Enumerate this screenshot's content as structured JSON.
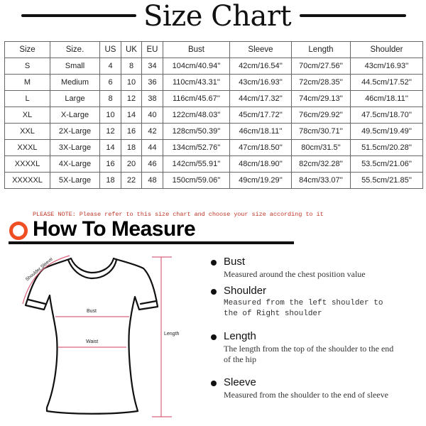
{
  "header": {
    "title": "Size Chart"
  },
  "size_table": {
    "columns": [
      "Size",
      "Size.",
      "US",
      "UK",
      "EU",
      "Bust",
      "Sleeve",
      "Length",
      "Shoulder"
    ],
    "rows": [
      [
        "S",
        "Small",
        "4",
        "8",
        "34",
        "104cm/40.94''",
        "42cm/16.54''",
        "70cm/27.56''",
        "43cm/16.93''"
      ],
      [
        "M",
        "Medium",
        "6",
        "10",
        "36",
        "110cm/43.31''",
        "43cm/16.93''",
        "72cm/28.35''",
        "44.5cm/17.52''"
      ],
      [
        "L",
        "Large",
        "8",
        "12",
        "38",
        "116cm/45.67''",
        "44cm/17.32''",
        "74cm/29.13''",
        "46cm/18.11''"
      ],
      [
        "XL",
        "X-Large",
        "10",
        "14",
        "40",
        "122cm/48.03''",
        "45cm/17.72''",
        "76cm/29.92''",
        "47.5cm/18.70''"
      ],
      [
        "XXL",
        "2X-Large",
        "12",
        "16",
        "42",
        "128cm/50.39''",
        "46cm/18.11''",
        "78cm/30.71''",
        "49.5cm/19.49''"
      ],
      [
        "XXXL",
        "3X-Large",
        "14",
        "18",
        "44",
        "134cm/52.76''",
        "47cm/18.50''",
        "80cm/31.5''",
        "51.5cm/20.28''"
      ],
      [
        "XXXXL",
        "4X-Large",
        "16",
        "20",
        "46",
        "142cm/55.91''",
        "48cm/18.90''",
        "82cm/32.28''",
        "53.5cm/21.06''"
      ],
      [
        "XXXXXL",
        "5X-Large",
        "18",
        "22",
        "48",
        "150cm/59.06''",
        "49cm/19.29''",
        "84cm/33.07''",
        "55.5cm/21.85''"
      ]
    ]
  },
  "note": "PLEASE NOTE: Please refer to this size chart and choose your size according to it",
  "how_to_measure": {
    "title": "How To Measure",
    "icon": "circle-ring-icon",
    "accent_color": "#f04e23",
    "diagram_labels": {
      "shoulder_sleeve": "Shoulder Sleeve",
      "bust": "Bust",
      "waist": "Waist",
      "length": "Length"
    },
    "items": [
      {
        "title": "Bust",
        "description": "Measured around the chest position value"
      },
      {
        "title": "Shoulder",
        "description": "Measured from the left shoulder to the of Right shoulder"
      },
      {
        "title": "Length",
        "description": "The length from the top of the shoulder to the end of the hip"
      },
      {
        "title": "Sleeve",
        "description": "Measured from the shoulder to the end of sleeve"
      }
    ]
  },
  "colors": {
    "note_text": "#c0392b",
    "measure_lines": "#d9637a"
  }
}
